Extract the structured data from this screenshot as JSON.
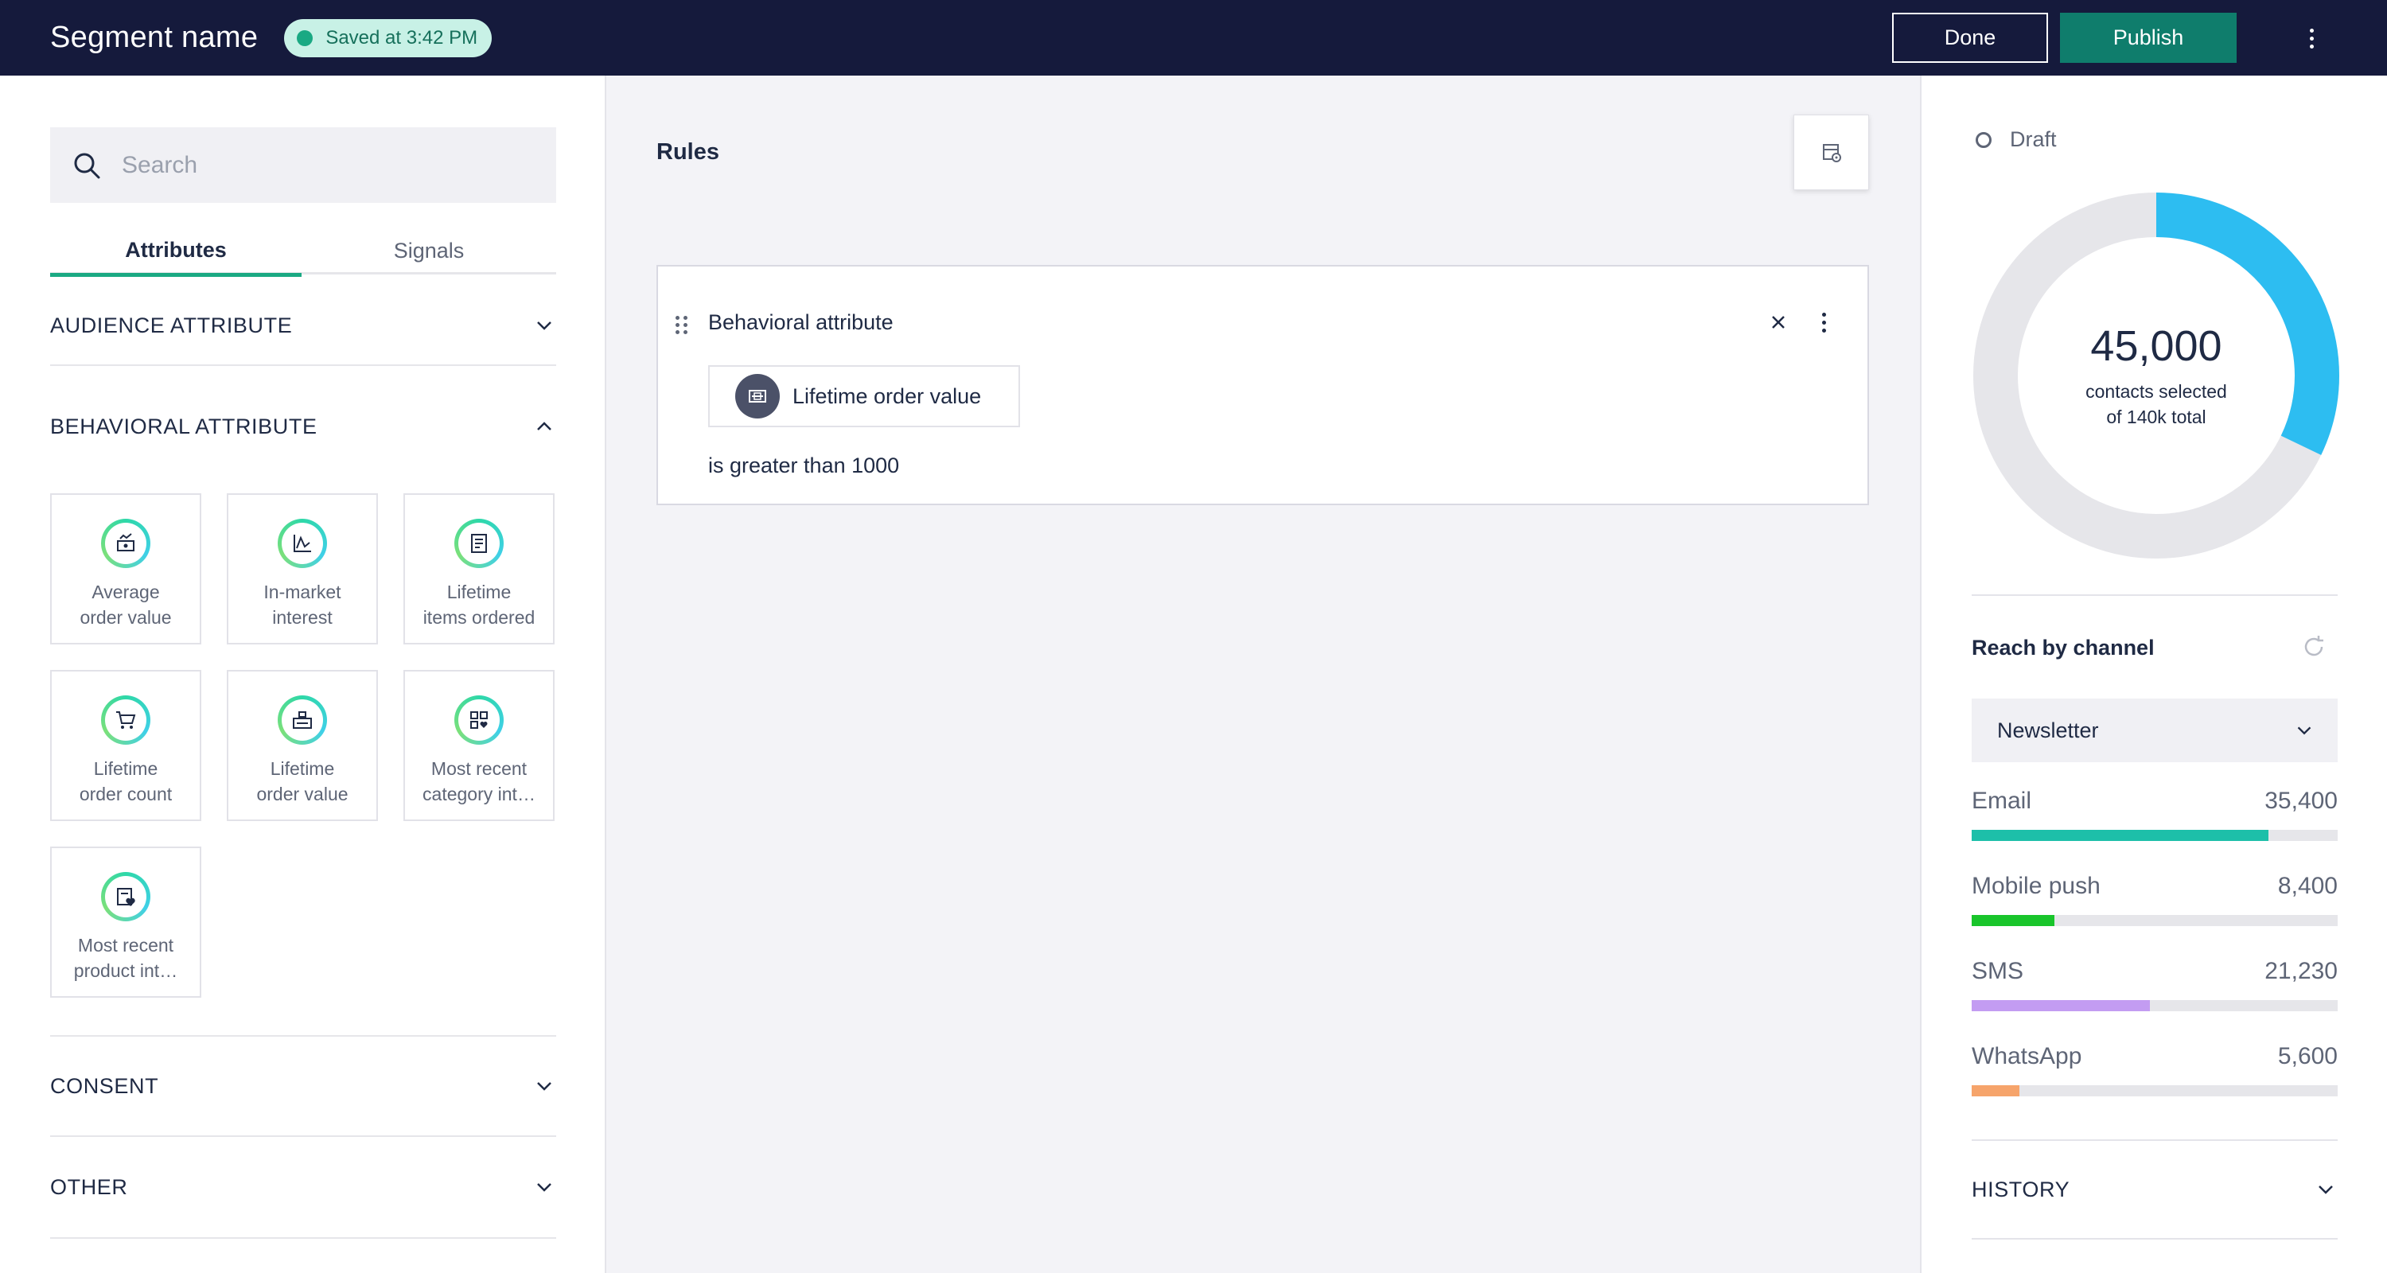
{
  "header": {
    "title": "Segment name",
    "saved_status": "Saved at 3:42 PM",
    "done_label": "Done",
    "publish_label": "Publish"
  },
  "left_panel": {
    "search_placeholder": "Search",
    "tabs": [
      {
        "label": "Attributes",
        "active": true
      },
      {
        "label": "Signals",
        "active": false
      }
    ],
    "sections": {
      "audience": {
        "label": "AUDIENCE ATTRIBUTE",
        "expanded": false
      },
      "behavioral": {
        "label": "BEHAVIORAL ATTRIBUTE",
        "expanded": true
      },
      "consent": {
        "label": "CONSENT",
        "expanded": false
      },
      "other": {
        "label": "OTHER",
        "expanded": false
      }
    },
    "tiles": [
      {
        "label": "Average\norder value",
        "icon": "order-value-icon"
      },
      {
        "label": "In-market\ninterest",
        "icon": "trend-chart-icon"
      },
      {
        "label": "Lifetime\nitems ordered",
        "icon": "items-list-icon"
      },
      {
        "label": "Lifetime\norder count",
        "icon": "cart-icon"
      },
      {
        "label": "Lifetime\norder value",
        "icon": "cash-register-icon"
      },
      {
        "label": "Most recent\ncategory int…",
        "icon": "category-grid-icon"
      },
      {
        "label": "Most recent\nproduct int…",
        "icon": "product-heart-icon"
      }
    ]
  },
  "center": {
    "title": "Rules",
    "rule": {
      "heading": "Behavioral attribute",
      "chip_label": "Lifetime order value",
      "condition": "is greater than 1000"
    }
  },
  "right_panel": {
    "status": "Draft",
    "donut": {
      "count": "45,000",
      "subtitle": "contacts selected\nof 140k total",
      "selected_fraction": 0.3214,
      "colors": {
        "selected": "#2dbdf1",
        "track": "#e6e6ea"
      }
    },
    "reach_title": "Reach by channel",
    "channel_select": "Newsletter",
    "channels": [
      {
        "name": "Email",
        "value": "35,400",
        "fraction": 0.81,
        "color": "#1dbfa9"
      },
      {
        "name": "Mobile push",
        "value": "8,400",
        "fraction": 0.225,
        "color": "#19c52b"
      },
      {
        "name": "SMS",
        "value": "21,230",
        "fraction": 0.487,
        "color": "#c39cf2"
      },
      {
        "name": "WhatsApp",
        "value": "5,600",
        "fraction": 0.13,
        "color": "#f6a46b"
      }
    ],
    "history_label": "HISTORY"
  }
}
